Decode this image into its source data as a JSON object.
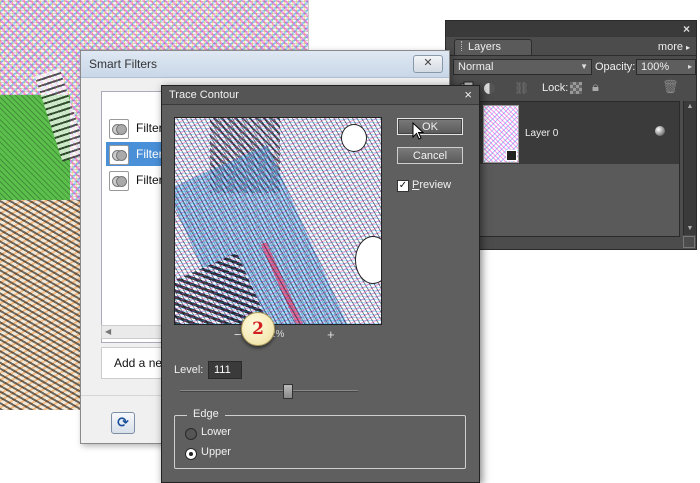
{
  "layers_panel": {
    "tab_label": "Layers",
    "more_label": "more",
    "blend_mode": "Normal",
    "opacity_label": "Opacity:",
    "opacity_value": "100%",
    "lock_label": "Lock:",
    "layers": [
      {
        "name": "Layer 0"
      }
    ]
  },
  "smart_filters": {
    "title": "Smart Filters",
    "close_label": "✕",
    "items": [
      {
        "label": "Filter"
      },
      {
        "label": "Filter",
        "selected": true
      },
      {
        "label": "Filter"
      }
    ],
    "add_new_label": "Add a new"
  },
  "trace_contour": {
    "title": "Trace Contour",
    "close_label": "×",
    "ok_label": "OK",
    "cancel_label": "Cancel",
    "preview_label_underlined": "P",
    "preview_label_rest": "review",
    "preview_checked": true,
    "zoom_minus": "−",
    "zoom_value": "2%",
    "zoom_plus": "+",
    "callout_number": "2",
    "level_label": "Level:",
    "level_value": "111",
    "level_slider_fraction": 0.6,
    "edge_label": "Edge",
    "edge_options": [
      {
        "label": "Lower",
        "selected": false
      },
      {
        "label": "Upper",
        "selected": true
      }
    ]
  }
}
